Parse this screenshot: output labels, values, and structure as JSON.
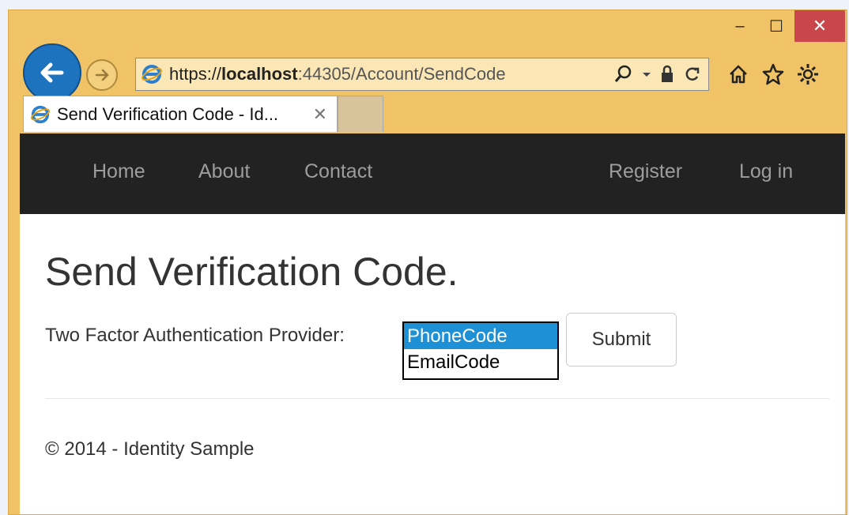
{
  "browser": {
    "window_controls": {
      "minimize": "–",
      "maximize": "☐",
      "close": "✕"
    },
    "address": {
      "scheme": "https://",
      "host": "localhost",
      "rest": ":44305/Account/SendCode"
    },
    "tab": {
      "title": "Send Verification Code - Id...",
      "close": "✕"
    }
  },
  "navbar": {
    "left_links": [
      "Home",
      "About",
      "Contact"
    ],
    "right_links": [
      "Register",
      "Log in"
    ]
  },
  "main": {
    "title": "Send Verification Code.",
    "provider_label": "Two Factor Authentication Provider:",
    "provider_options": [
      "PhoneCode",
      "EmailCode"
    ],
    "selected_option": "PhoneCode",
    "submit_label": "Submit"
  },
  "footer": {
    "text": "© 2014 - Identity Sample"
  },
  "colors": {
    "chrome": "#f0c466",
    "navbar": "#222222",
    "selection": "#1e90d6",
    "close_button": "#c9474b"
  }
}
